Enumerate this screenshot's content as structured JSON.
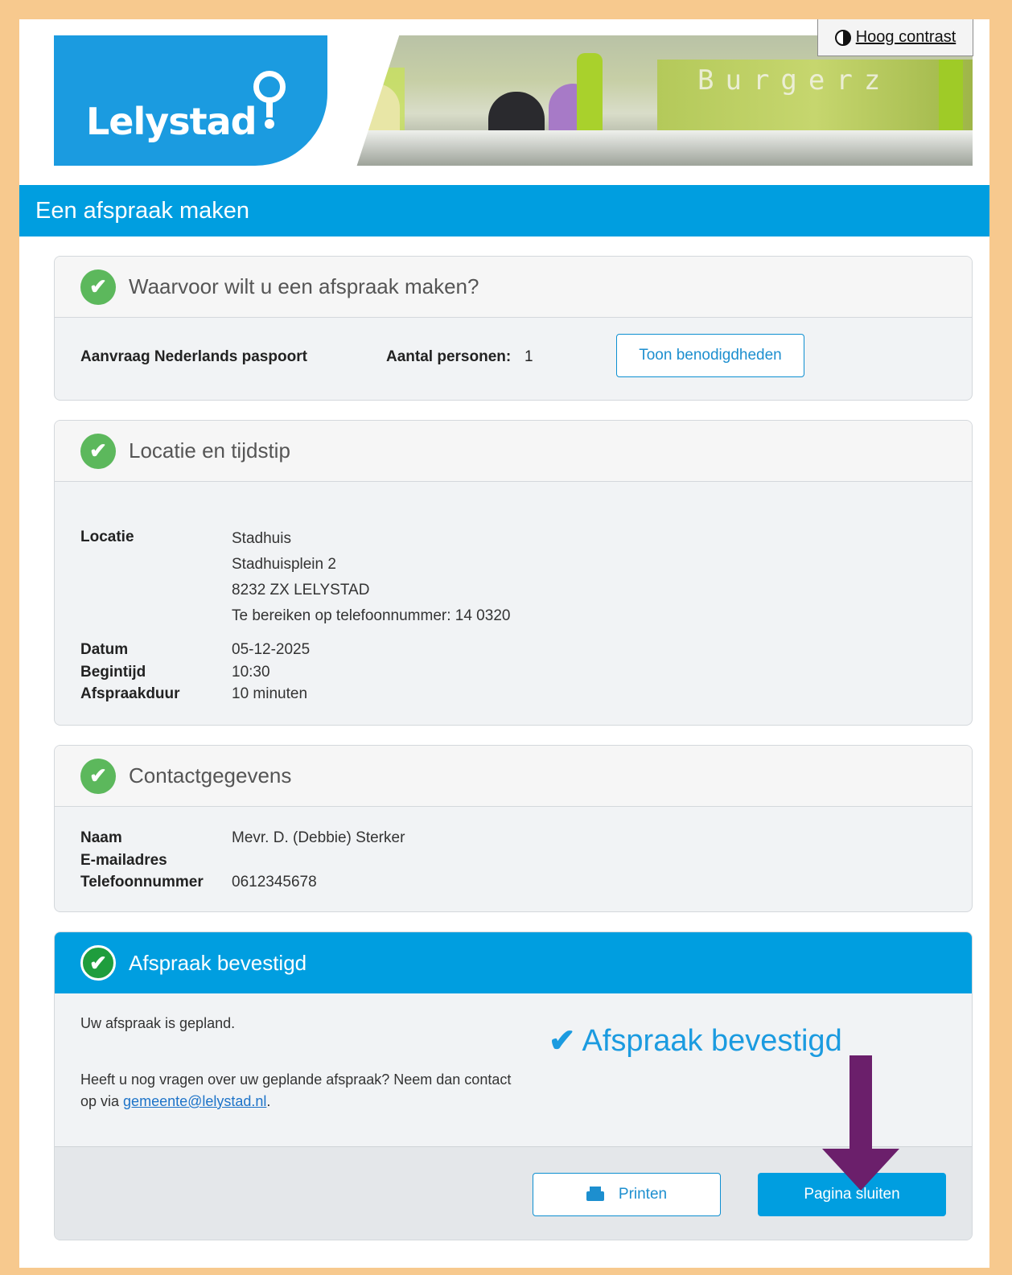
{
  "header": {
    "logo_text": "Lelystad",
    "photo_sign": "Burgerz",
    "contrast_label": "Hoog contrast",
    "page_title": "Een afspraak maken"
  },
  "section_purpose": {
    "title": "Waarvoor wilt u een afspraak maken?",
    "product": "Aanvraag Nederlands paspoort",
    "persons_label": "Aantal personen:",
    "persons_value": "1",
    "requirements_button": "Toon benodigdheden"
  },
  "section_location": {
    "title": "Locatie en tijdstip",
    "location_label": "Locatie",
    "location_lines": [
      "Stadhuis",
      "Stadhuisplein 2",
      "8232 ZX LELYSTAD",
      "Te bereiken op telefoonnummer: 14 0320"
    ],
    "date_label": "Datum",
    "date_value": "05-12-2025",
    "start_label": "Begintijd",
    "start_value": "10:30",
    "duration_label": "Afspraakduur",
    "duration_value": "10 minuten"
  },
  "section_contact": {
    "title": "Contactgegevens",
    "name_label": "Naam",
    "name_value": "Mevr. D. (Debbie) Sterker",
    "email_label": "E-mailadres",
    "email_value": "",
    "phone_label": "Telefoonnummer",
    "phone_value": "0612345678"
  },
  "section_confirmed": {
    "title": "Afspraak bevestigd",
    "planned_text": "Uw afspraak is gepland.",
    "questions_text": "Heeft u nog vragen over uw geplande afspraak? Neem dan contact op via ",
    "email_link": "gemeente@lelystad.nl",
    "questions_end": ".",
    "confirm_banner": "Afspraak bevestigd",
    "print_button": "Printen",
    "close_button": "Pagina sluiten"
  },
  "colors": {
    "page_border": "#f7c98e",
    "brand_blue": "#009ee0",
    "success_green": "#5cb85c",
    "annotation_arrow": "#6b1f6b"
  }
}
